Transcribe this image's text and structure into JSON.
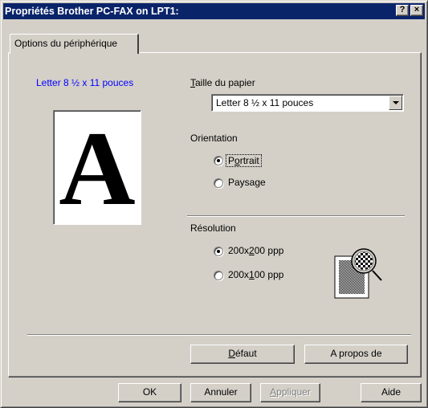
{
  "window": {
    "title": "Propriétés Brother PC-FAX on LPT1:",
    "help_button": "?",
    "close_button": "×"
  },
  "tabs": [
    {
      "label": "Options du périphérique",
      "selected": true
    }
  ],
  "preview": {
    "paper_label": "Letter 8 ½ x 11 pouces",
    "letter": "A"
  },
  "paper_size": {
    "label_prefix": "",
    "label_mnemonic": "T",
    "label_rest": "aille du papier",
    "selected": "Letter 8 ½ x 11 pouces"
  },
  "orientation": {
    "label": "Orientation",
    "options": [
      {
        "pre": "P",
        "mnemonic": "o",
        "post": "rtrait",
        "checked": true
      },
      {
        "pre": "Paysa",
        "mnemonic": "g",
        "post": "e",
        "checked": false
      }
    ]
  },
  "resolution": {
    "label": "Résolution",
    "options": [
      {
        "pre": "200x",
        "mnemonic": "2",
        "post": "00 ppp",
        "checked": true
      },
      {
        "pre": "200x",
        "mnemonic": "1",
        "post": "00 ppp",
        "checked": false
      }
    ]
  },
  "panel_buttons": {
    "default": {
      "pre": "",
      "mnemonic": "D",
      "post": "éfaut"
    },
    "about": "A propos de"
  },
  "dialog_buttons": {
    "ok": "OK",
    "cancel": "Annuler",
    "apply": {
      "pre": "",
      "mnemonic": "A",
      "post": "ppliquer",
      "enabled": false
    },
    "help": "Aide"
  },
  "colors": {
    "titlebar": "#0a246a",
    "face": "#d4d0c8",
    "preview_label": "#0000ff"
  }
}
